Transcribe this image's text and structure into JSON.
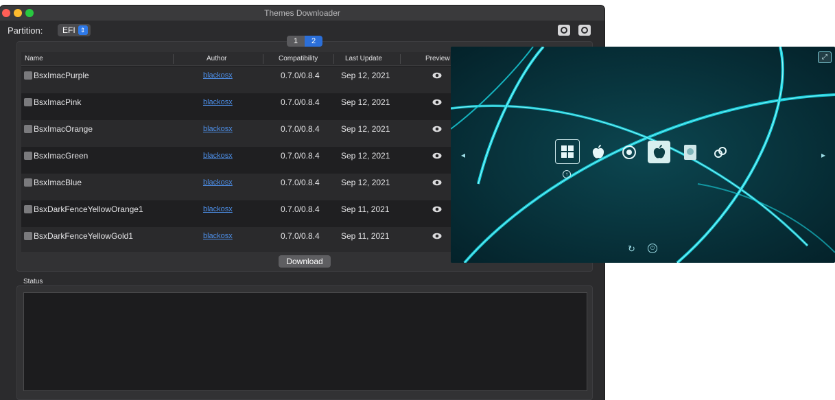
{
  "window": {
    "title": "Themes Downloader"
  },
  "toolbar": {
    "partition_label": "Partition:",
    "partition_value": "EFI"
  },
  "pager": {
    "pages": [
      "1",
      "2"
    ],
    "current": "2"
  },
  "table": {
    "headers": {
      "name": "Name",
      "author": "Author",
      "compat": "Compatibility",
      "update": "Last Update",
      "preview": "Preview"
    },
    "rows": [
      {
        "name": "BsxImacPurple",
        "author": "blackosx",
        "compat": "0.7.0/0.8.4",
        "update": "Sep 12, 2021"
      },
      {
        "name": "BsxImacPink",
        "author": "blackosx",
        "compat": "0.7.0/0.8.4",
        "update": "Sep 12, 2021"
      },
      {
        "name": "BsxImacOrange",
        "author": "blackosx",
        "compat": "0.7.0/0.8.4",
        "update": "Sep 12, 2021"
      },
      {
        "name": "BsxImacGreen",
        "author": "blackosx",
        "compat": "0.7.0/0.8.4",
        "update": "Sep 12, 2021"
      },
      {
        "name": "BsxImacBlue",
        "author": "blackosx",
        "compat": "0.7.0/0.8.4",
        "update": "Sep 12, 2021"
      },
      {
        "name": "BsxDarkFenceYellowOrange1",
        "author": "blackosx",
        "compat": "0.7.0/0.8.4",
        "update": "Sep 11, 2021"
      },
      {
        "name": "BsxDarkFenceYellowGold1",
        "author": "blackosx",
        "compat": "0.7.0/0.8.4",
        "update": "Sep 11, 2021"
      }
    ]
  },
  "actions": {
    "download_label": "Download"
  },
  "status": {
    "label": "Status",
    "text": ""
  },
  "colors": {
    "accent": "#2b6fd9",
    "link": "#4d8fe8",
    "preview_bg": "#072a31",
    "preview_glow": "#19d3e0"
  },
  "preview_icons": [
    "windows-icon",
    "apple-icon",
    "recovery-icon",
    "apple-icon",
    "disk-icon",
    "link-icon"
  ]
}
